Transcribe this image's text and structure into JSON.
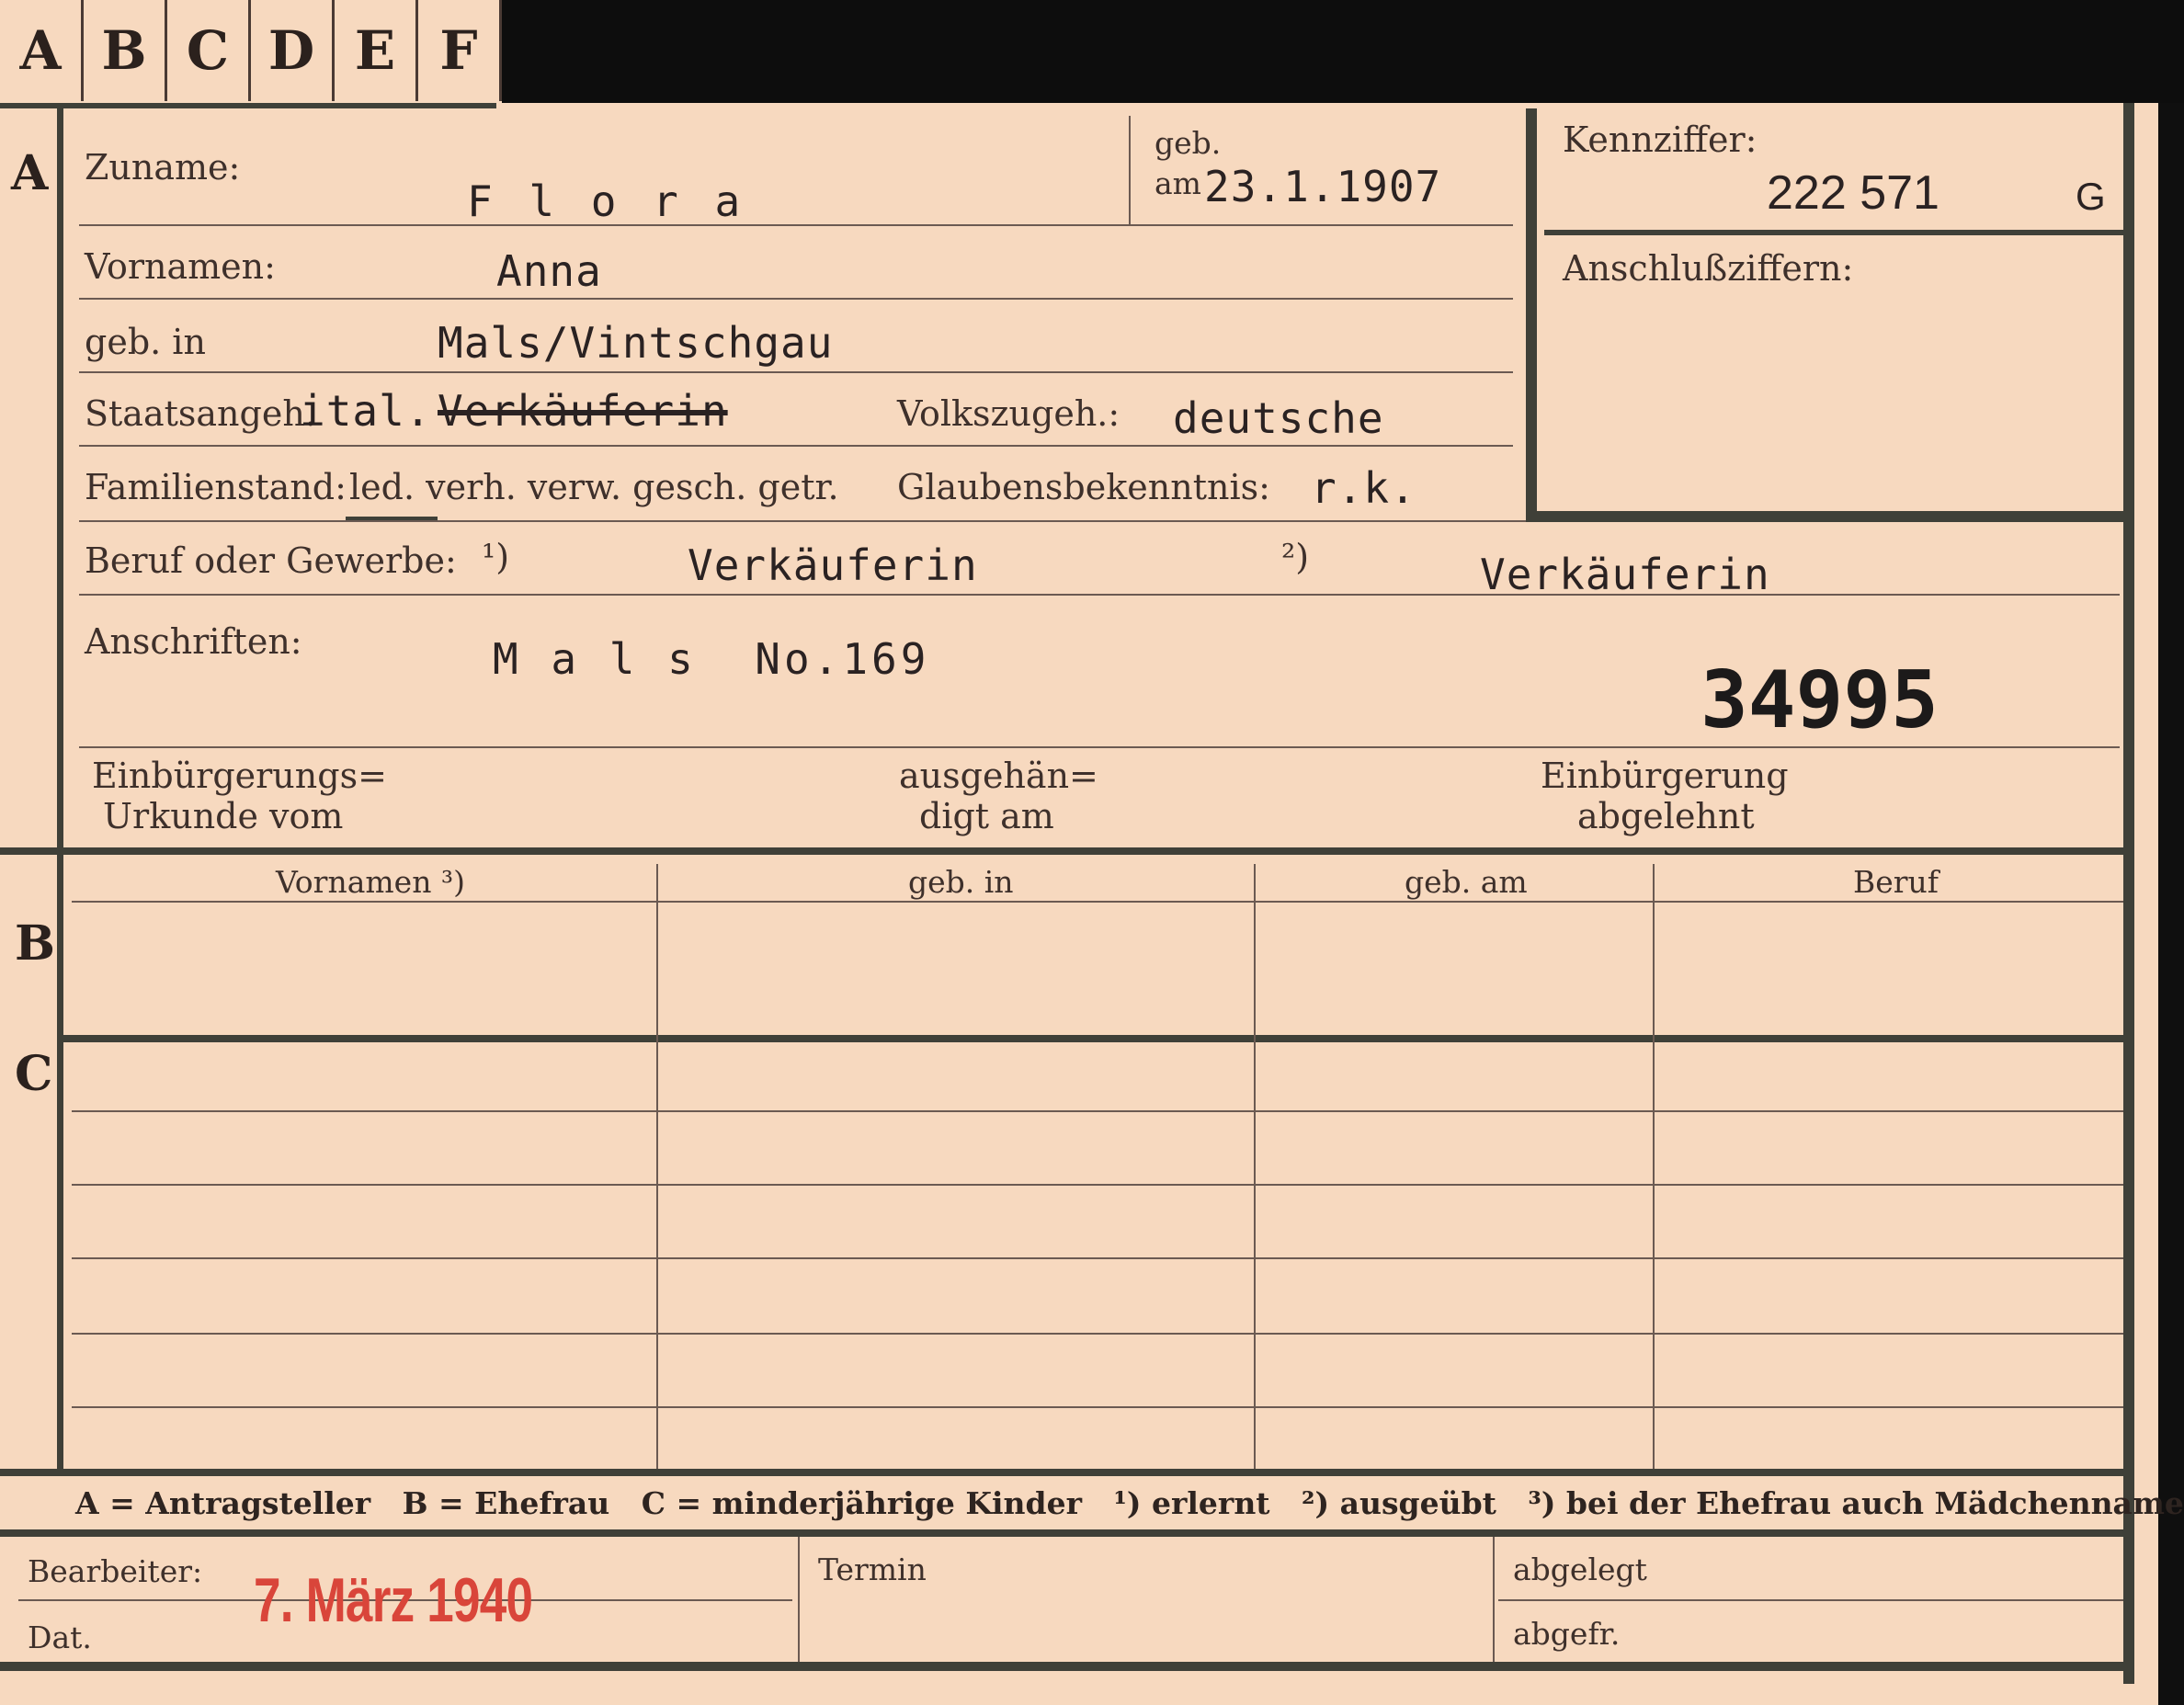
{
  "tabs": [
    "A",
    "B",
    "C",
    "D",
    "E",
    "F"
  ],
  "sections": {
    "a": "A",
    "b": "B",
    "c": "C"
  },
  "labels": {
    "zuname": "Zuname:",
    "geb_am_1": "geb.",
    "geb_am_2": "am",
    "kennziffer": "Kennziffer:",
    "vornamen": "Vornamen:",
    "anschluss": "Anschlußziffern:",
    "geb_in": "geb. in",
    "staatsangeh": "Staatsangeh.",
    "volkszugeh": "Volkszugeh.:",
    "familienstand": "Familienstand:",
    "familienstand_options": "led. verh. verw. gesch. getr.",
    "glaube": "Glaubensbekenntnis:",
    "beruf": "Beruf oder Gewerbe:",
    "fn1": "¹)",
    "fn2": "²)",
    "anschriften": "Anschriften:",
    "einb_urkunde_1": "Einbürgerungs=",
    "einb_urkunde_2": "Urkunde vom",
    "ausgeh_1": "ausgehän=",
    "ausgeh_2": "digt am",
    "einb_abgelehnt_1": "Einbürgerung",
    "einb_abgelehnt_2": "abgelehnt",
    "bearbeiter": "Bearbeiter:",
    "dat": "Dat.",
    "termin": "Termin",
    "abgelegt": "abgelegt",
    "abgefr": "abgefr."
  },
  "values": {
    "zuname": "F l o r a",
    "geb_am": "23.1.1907",
    "kennziffer": "222 571",
    "kennziffer_suffix": "G",
    "vornamen": "Anna",
    "geb_in": "Mals/Vintschgau",
    "staatsangeh": "ital.",
    "staatsangeh_struck": "Verkäuferin",
    "volkszugeh": "deutsche",
    "glaube": "r.k.",
    "beruf_erlernt": "Verkäuferin",
    "beruf_ausgeuebt": "Verkäuferin",
    "anschrift": "M a l s  No.169",
    "number": "34995",
    "stamp": "7. März 1940"
  },
  "table_headers": [
    "Vornamen ³)",
    "geb. in",
    "geb. am",
    "Beruf"
  ],
  "legend": "A = Antragsteller   B = Ehefrau   C = minderjährige Kinder   ¹) erlernt   ²) ausgeübt   ³) bei der Ehefrau auch Mädchenname"
}
